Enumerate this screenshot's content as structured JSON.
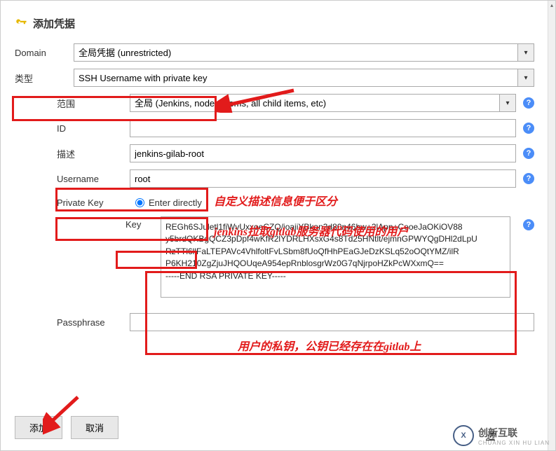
{
  "header": {
    "title": "添加凭据"
  },
  "form": {
    "domain_label": "Domain",
    "domain_value": "全局凭据 (unrestricted)",
    "type_label": "类型",
    "type_value": "SSH Username with private key",
    "scope_label": "范围",
    "scope_value": "全局 (Jenkins, nodes, items, all child items, etc)",
    "id_label": "ID",
    "id_value": "",
    "desc_label": "描述",
    "desc_value": "jenkins-gilab-root",
    "username_label": "Username",
    "username_value": "root",
    "privatekey_label": "Private Key",
    "enter_directly_label": "Enter directly",
    "key_label": "Key",
    "key_value": "REGh6SJuletl1fiWvUxxoeCZQ/ioajiYBkan3d80n46hw+2lApn+CeoeJaOKiOV88\ny5brdQKBgQCZ3pDpf4wKfR2lYDRLHXsxG4s8Td25HNtlt/ejmnGPWYQgDHl2dLpU\nRzTTl6llFaLTEPAVc4VhlfoltFvLSbm8fUoQfHhPEaGJeDzKSLq52oOQtYMZ/ilR\nP6KH210ZgZjuJHQOUqeA954epRnblosgrWz0G7qNjrpoHZkPcWXxmQ==\n-----END RSA PRIVATE KEY-----",
    "passphrase_label": "Passphrase",
    "passphrase_value": ""
  },
  "buttons": {
    "add": "添加",
    "cancel": "取消"
  },
  "annotations": {
    "desc_note": "自定义描述信息便于区分",
    "user_note": "jenkins拉取gitlab服务器代码使用的用户",
    "key_note": "用户的私钥，公钥已经存在在gitlab上"
  },
  "footer": {
    "page_indicator": "边",
    "brand_cn": "创新互联",
    "brand_en": "CHUANG XIN HU LIAN",
    "brand_mark": "X"
  }
}
